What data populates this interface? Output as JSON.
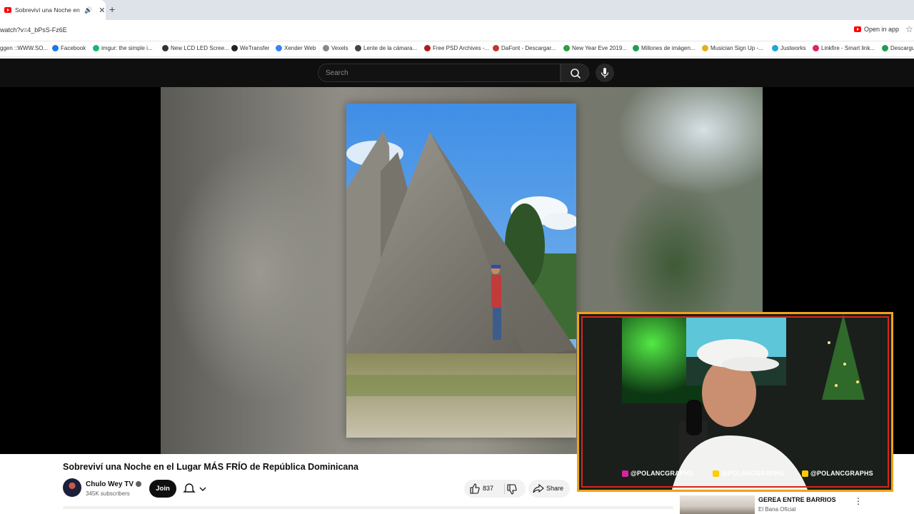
{
  "browser": {
    "tab_title": "Sobreviví una Noche en el L",
    "url": "watch?v=4_bPsS-Fz6E",
    "open_in_app": "Open in app",
    "bookmarks": [
      {
        "label": "ggen ::WWW.SO...",
        "color": "#4a8f3a"
      },
      {
        "label": "Facebook",
        "color": "#1877f2"
      },
      {
        "label": "imgur: the simple i...",
        "color": "#1bb76e"
      },
      {
        "label": "New LCD LED Scree...",
        "color": "#333333"
      },
      {
        "label": "WeTransfer",
        "color": "#222222"
      },
      {
        "label": "Xender Web",
        "color": "#3b82f6"
      },
      {
        "label": "Vexels",
        "color": "#888888"
      },
      {
        "label": "Lente de la cámara...",
        "color": "#444444"
      },
      {
        "label": "Free PSD Archives -...",
        "color": "#b01b1b"
      },
      {
        "label": "DaFont - Descargar...",
        "color": "#c0392b"
      },
      {
        "label": "New Year Eve 2019...",
        "color": "#2e9e44"
      },
      {
        "label": "Millones de imágen...",
        "color": "#1f9d55"
      },
      {
        "label": "Musician Sign Up -...",
        "color": "#e0b020"
      },
      {
        "label": "Justworks",
        "color": "#1ea7d8"
      },
      {
        "label": "Linkfire - Smart link...",
        "color": "#e0245e"
      },
      {
        "label": "Descargu...",
        "color": "#1f9d55"
      }
    ]
  },
  "youtube": {
    "search_placeholder": "Search",
    "video_title": "Sobreviví una Noche en el Lugar MÁS FRÍO de República Dominicana",
    "channel_name": "Chulo Wey TV",
    "subscribers": "345K subscribers",
    "join_label": "Join",
    "like_count": "837",
    "share_label": "Share",
    "recommendation": {
      "title": "GEREA ENTRE BARRIOS",
      "subtitle": "El Bana Oficial"
    }
  },
  "webcam_overlay": {
    "handles": [
      {
        "platform": "instagram-icon",
        "text": "@POLANCGRAPHS",
        "color": "#d6249f"
      },
      {
        "platform": "youtube-icon",
        "text": "@POLANCGRAPHS",
        "color": "#ffcc00"
      },
      {
        "platform": "facebook-icon",
        "text": "@POLANCGRAPHS",
        "color": "#ffcc00"
      }
    ],
    "frame_color": "#f1a317",
    "accent_color": "#d9261c"
  }
}
